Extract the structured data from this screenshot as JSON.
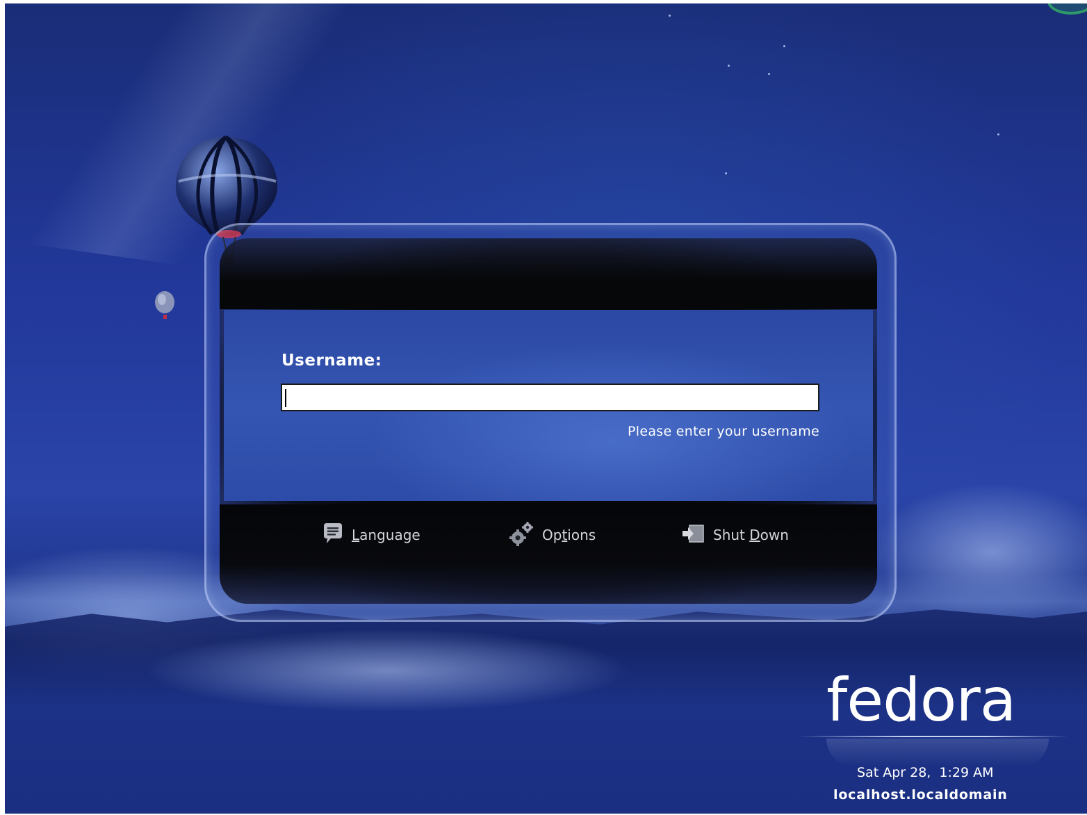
{
  "login": {
    "username_label": "Username:",
    "username_value": "",
    "hint": "Please enter your username"
  },
  "actions": {
    "language": {
      "label_mnemonic": "L",
      "label_rest": "anguage",
      "icon": "speech-bubble-icon"
    },
    "options": {
      "label_pre": "Op",
      "label_mnemonic": "t",
      "label_rest": "ions",
      "icon": "gears-icon"
    },
    "shutdown": {
      "label_pre": "Shut ",
      "label_mnemonic": "D",
      "label_rest": "own",
      "icon": "shutdown-icon"
    }
  },
  "branding": {
    "logo_text": "fedora"
  },
  "status": {
    "datetime": "Sat Apr 28,  1:29 AM",
    "hostname": "localhost.localdomain"
  },
  "colors": {
    "background": "#22389a",
    "panel": "#3456b2",
    "dialog_dark": "#050709",
    "text": "#ffffff",
    "button_text": "#d4d6dc"
  }
}
